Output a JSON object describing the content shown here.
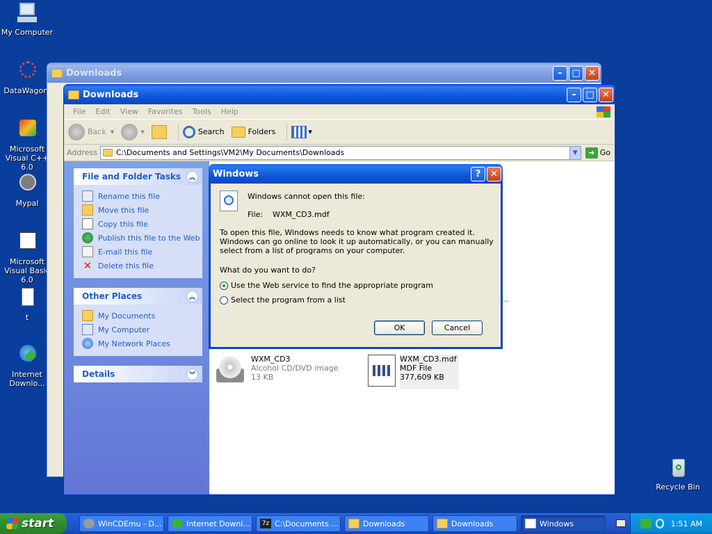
{
  "desktop": {
    "icons": [
      {
        "label": "My Computer",
        "icon": "my-computer-icon"
      },
      {
        "label": "DataWagon.",
        "icon": "datawagon-icon"
      },
      {
        "label": "Microsoft Visual C++ 6.0",
        "icon": "visual-cpp-icon"
      },
      {
        "label": "Mypal",
        "icon": "mypal-icon"
      },
      {
        "label": "Microsoft Visual Basic 6.0",
        "icon": "visual-basic-icon"
      },
      {
        "label": "t",
        "icon": "text-file-icon"
      },
      {
        "label": "Internet Downlo...",
        "icon": "internet-download-icon"
      },
      {
        "label": "Recycle Bin",
        "icon": "recycle-bin-icon"
      }
    ]
  },
  "back_window": {
    "title": "Downloads"
  },
  "explorer": {
    "title": "Downloads",
    "menu": [
      "File",
      "Edit",
      "View",
      "Favorites",
      "Tools",
      "Help"
    ],
    "toolbar": {
      "back": "Back",
      "search": "Search",
      "folders": "Folders"
    },
    "address_label": "Address",
    "address_value": "C:\\Documents and Settings\\VM2\\My Documents\\Downloads",
    "go": "Go",
    "panels": {
      "file_tasks": {
        "title": "File and Folder Tasks",
        "items": [
          "Rename this file",
          "Move this file",
          "Copy this file",
          "Publish this file to the Web",
          "E-mail this file",
          "Delete this file"
        ]
      },
      "other_places": {
        "title": "Other Places",
        "items": [
          "My Documents",
          "My Computer",
          "My Network Places"
        ]
      },
      "details": {
        "title": "Details"
      }
    },
    "files": [
      {
        "name": "WXM_CD3",
        "type": "Alcohol CD/DVD image",
        "size": "13 KB"
      },
      {
        "name": "WXM_CD3.mdf",
        "type": "MDF File",
        "size": "377,609 KB"
      }
    ]
  },
  "dialog": {
    "title": "Windows",
    "line1": "Windows cannot open this file:",
    "file_label": "File:",
    "file_name": "WXM_CD3.mdf",
    "paragraph": "To open this file, Windows needs to know what program created it.  Windows can go online to look it up automatically, or you can manually select from a list of programs on your computer.",
    "question": "What do you want to do?",
    "option1": "Use the Web service to find the appropriate program",
    "option2": "Select the program from a list",
    "ok": "OK",
    "cancel": "Cancel"
  },
  "taskbar": {
    "start": "start",
    "items": [
      "WinCDEmu - D...",
      "Internet Downl...",
      "C:\\Documents ...",
      "Downloads",
      "Downloads",
      "Windows"
    ],
    "clock": "1:51 AM"
  }
}
